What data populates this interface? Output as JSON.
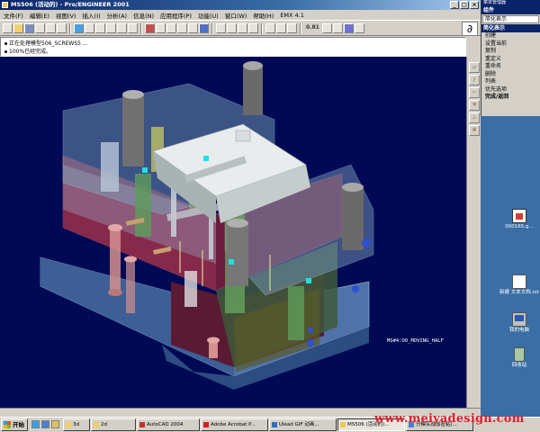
{
  "window": {
    "title": "MS506 (活动的) - Pro/ENGINEER 2001",
    "controls": [
      "_",
      "□",
      "×"
    ]
  },
  "menubar": [
    "文件(F)",
    "编辑(E)",
    "视图(V)",
    "插入(I)",
    "分析(A)",
    "信息(N)",
    "应用程序(P)",
    "功能(U)",
    "窗口(W)",
    "帮助(H)",
    "EMX 4.1"
  ],
  "toolbar": {
    "zoom_label": "0.81"
  },
  "messages": [
    "正在处理模型506_SCREWS5 ...",
    "100%已经完成。"
  ],
  "viewport": {
    "model_label": "MS#4:OO_MOVING_HALF"
  },
  "menu_manager": {
    "title": "菜单管理器",
    "head_component": "组件",
    "selector": "简化表示",
    "head_simplified": "简化表示",
    "items": [
      "创建",
      "设置当前",
      "复制",
      "重定义",
      "重命名",
      "删除",
      "列表",
      "优先选项"
    ],
    "done": "完成/返回"
  },
  "desktop": [
    {
      "label": "000165.g...",
      "icon": "image-file-icon"
    },
    {
      "label": "新建 文本文档.txt",
      "icon": "text-file-icon"
    },
    {
      "label": "我的电脑",
      "icon": "computer-icon"
    },
    {
      "label": "回收站",
      "icon": "recycle-bin-icon"
    }
  ],
  "taskbar": {
    "start": "开始",
    "tasks": [
      "3d",
      "2d",
      "AutoCAD 2004",
      "Adobe Acrobat P...",
      "Ulead GIF 动画...",
      "MS506 (活动的)...",
      "分模实战加密粘(..."
    ]
  },
  "watermark": "www.meiyadesign.com",
  "colors": {
    "viewport_bg": "#000a54",
    "titlebar": "#0a246a",
    "desktop": "#3a6ea5",
    "watermark": "#e0202c"
  }
}
